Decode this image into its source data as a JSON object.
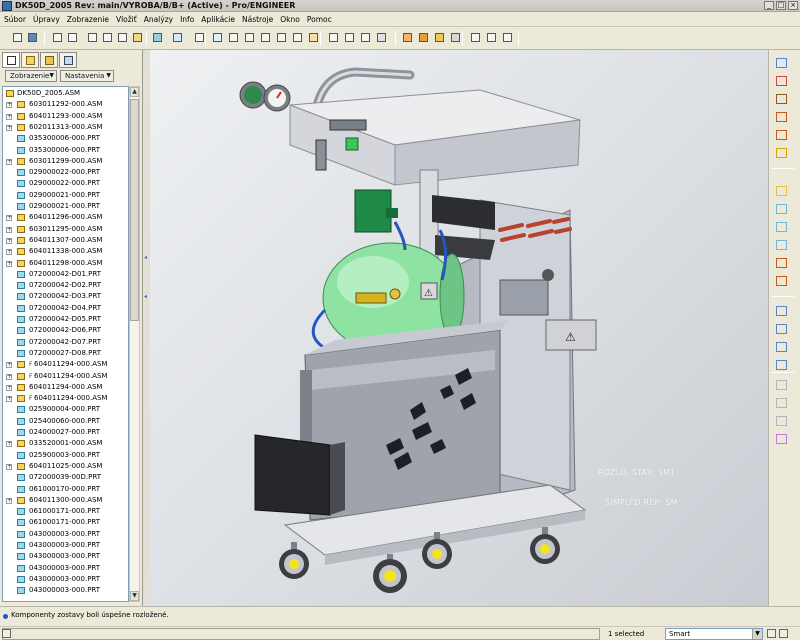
{
  "window": {
    "title": "DK50D_2005 Rev: main/VYROBA/B/B+ (Active) - Pro/ENGINEER",
    "minimize_glyph": "_",
    "maximize_glyph": "□",
    "close_glyph": "×"
  },
  "menu": [
    "Súbor",
    "Úpravy",
    "Zobrazenie",
    "Vložiť",
    "Analýzy",
    "Info",
    "Aplikácie",
    "Nástroje",
    "Okno",
    "Pomoc"
  ],
  "toolbar": {
    "icons": [
      "print-icon",
      "save-icon",
      "undo-icon",
      "redo-icon",
      "cut-icon",
      "copy-icon",
      "paste-icon",
      "paste-special-icon",
      "regenerate-icon",
      "find-icon",
      "select-box-icon",
      "repaint-icon",
      "zoom-in-icon",
      "zoom-out-icon",
      "refit-icon",
      "orient-icon",
      "saved-views-icon",
      "layers-icon",
      "wireframe-icon",
      "hidden-line-icon",
      "no-hidden-icon",
      "shading-icon",
      "datum-planes-icon",
      "datum-axes-icon",
      "datum-points-icon",
      "csys-icon",
      "relations-icon",
      "family-table-icon",
      "context-help-icon"
    ]
  },
  "navigator": {
    "tab_icons": [
      "model-tree-icon",
      "folder-browser-icon",
      "favorites-icon",
      "connections-icon"
    ],
    "view_menu_label": "Zobrazenie",
    "settings_menu_label": "Nastavenia",
    "tree": [
      {
        "label": "DK50D_2005.ASM",
        "type": "asm",
        "level": 0,
        "expander": false
      },
      {
        "label": "603011292-000.ASM",
        "type": "asm",
        "level": 1,
        "expander": true
      },
      {
        "label": "604011293-000.ASM",
        "type": "asm",
        "level": 1,
        "expander": true
      },
      {
        "label": "602011313-000.ASM",
        "type": "asm",
        "level": 1,
        "expander": true
      },
      {
        "label": "035300006-000.PRT",
        "type": "prt",
        "level": 1,
        "expander": false
      },
      {
        "label": "035300006-000.PRT",
        "type": "prt",
        "level": 1,
        "expander": false
      },
      {
        "label": "603011299-000.ASM",
        "type": "asm",
        "level": 1,
        "expander": true
      },
      {
        "label": "029000022-000.PRT",
        "type": "prt",
        "level": 1,
        "expander": false
      },
      {
        "label": "029000022-000.PRT",
        "type": "prt",
        "level": 1,
        "expander": false
      },
      {
        "label": "029000021-000.PRT",
        "type": "prt",
        "level": 1,
        "expander": false
      },
      {
        "label": "029000021-000.PRT",
        "type": "prt",
        "level": 1,
        "expander": false
      },
      {
        "label": "604011296-000.ASM",
        "type": "asm",
        "level": 1,
        "expander": true
      },
      {
        "label": "603011295-000.ASM",
        "type": "asm",
        "level": 1,
        "expander": true
      },
      {
        "label": "604011307-000.ASM",
        "type": "asm",
        "level": 1,
        "expander": true
      },
      {
        "label": "604011338-000.ASM",
        "type": "asm",
        "level": 1,
        "expander": true
      },
      {
        "label": "604011298-000.ASM",
        "type": "asm",
        "level": 1,
        "expander": true
      },
      {
        "label": "072000042-D01.PRT",
        "type": "prt",
        "level": 1,
        "expander": false
      },
      {
        "label": "072000042-D02.PRT",
        "type": "prt",
        "level": 1,
        "expander": false
      },
      {
        "label": "072000042-D03.PRT",
        "type": "prt",
        "level": 1,
        "expander": false
      },
      {
        "label": "072000042-D04.PRT",
        "type": "prt",
        "level": 1,
        "expander": false
      },
      {
        "label": "072000042-D05.PRT",
        "type": "prt",
        "level": 1,
        "expander": false
      },
      {
        "label": "072000042-D06.PRT",
        "type": "prt",
        "level": 1,
        "expander": false
      },
      {
        "label": "072000042-D07.PRT",
        "type": "prt",
        "level": 1,
        "expander": false
      },
      {
        "label": "072000027-D08.PRT",
        "type": "prt",
        "level": 1,
        "expander": false
      },
      {
        "label": "604011294-000.ASM",
        "type": "asm",
        "level": 1,
        "expander": true,
        "flag": "F"
      },
      {
        "label": "604011294-000.ASM",
        "type": "asm",
        "level": 1,
        "expander": true,
        "flag": "F"
      },
      {
        "label": "604011294-000.ASM",
        "type": "asm",
        "level": 1,
        "expander": true
      },
      {
        "label": "604011294-000.ASM",
        "type": "asm",
        "level": 1,
        "expander": true,
        "flag": "F"
      },
      {
        "label": "025900004-000.PRT",
        "type": "prt",
        "level": 1,
        "expander": false
      },
      {
        "label": "025400060-000.PRT",
        "type": "prt",
        "level": 1,
        "expander": false
      },
      {
        "label": "024000027-000.PRT",
        "type": "prt",
        "level": 1,
        "expander": false
      },
      {
        "label": "033520001-000.ASM",
        "type": "asm",
        "level": 1,
        "expander": true
      },
      {
        "label": "025900003-000.PRT",
        "type": "prt",
        "level": 1,
        "expander": false
      },
      {
        "label": "604011025-000.ASM",
        "type": "asm",
        "level": 1,
        "expander": true
      },
      {
        "label": "072000039-00D.PRT",
        "type": "prt",
        "level": 1,
        "expander": false
      },
      {
        "label": "061000170-000.PRT",
        "type": "prt",
        "level": 1,
        "expander": false
      },
      {
        "label": "604011300-000.ASM",
        "type": "asm",
        "level": 1,
        "expander": true
      },
      {
        "label": "061000171-000.PRT",
        "type": "prt",
        "level": 1,
        "expander": false
      },
      {
        "label": "061000171-000.PRT",
        "type": "prt",
        "level": 1,
        "expander": false
      },
      {
        "label": "043000003-000.PRT",
        "type": "prt",
        "level": 1,
        "expander": false
      },
      {
        "label": "043000003-000.PRT",
        "type": "prt",
        "level": 1,
        "expander": false
      },
      {
        "label": "043000003-000.PRT",
        "type": "prt",
        "level": 1,
        "expander": false
      },
      {
        "label": "043000003-000.PRT",
        "type": "prt",
        "level": 1,
        "expander": false
      },
      {
        "label": "043000003-000.PRT",
        "type": "prt",
        "level": 1,
        "expander": false
      },
      {
        "label": "043000003-000.PRT",
        "type": "prt",
        "level": 1,
        "expander": false
      }
    ]
  },
  "viewport": {
    "state_text_1": "ROZLO. STAV: SM1",
    "state_text_2": "SIMPLFD REP: SM"
  },
  "right_toolbar": {
    "icons": [
      "datum-plane-icon",
      "datum-axis-icon",
      "datum-curve-icon",
      "sketch-icon",
      "datum-point-icon",
      "csys-datum-icon",
      "hole-icon",
      "shell-icon",
      "rib-icon",
      "draft-icon",
      "round-icon",
      "chamfer-icon",
      "copy-feature-icon",
      "mirror-icon",
      "merge-icon",
      "pattern-icon",
      "intersect-icon",
      "trim-icon",
      "extend-icon",
      "offset-icon"
    ]
  },
  "status": {
    "message": "Komponenty zostavy boli úspešne rozložené.",
    "selected_count": "1 selected",
    "filter_value": "Smart"
  },
  "colors": {
    "tank_green": "#8ee3a2",
    "frame_gray": "#a9aeb8",
    "accent_blue": "#2456c0",
    "gauge_red": "#cc2a2a",
    "caster_yellow": "#f3e51c"
  }
}
